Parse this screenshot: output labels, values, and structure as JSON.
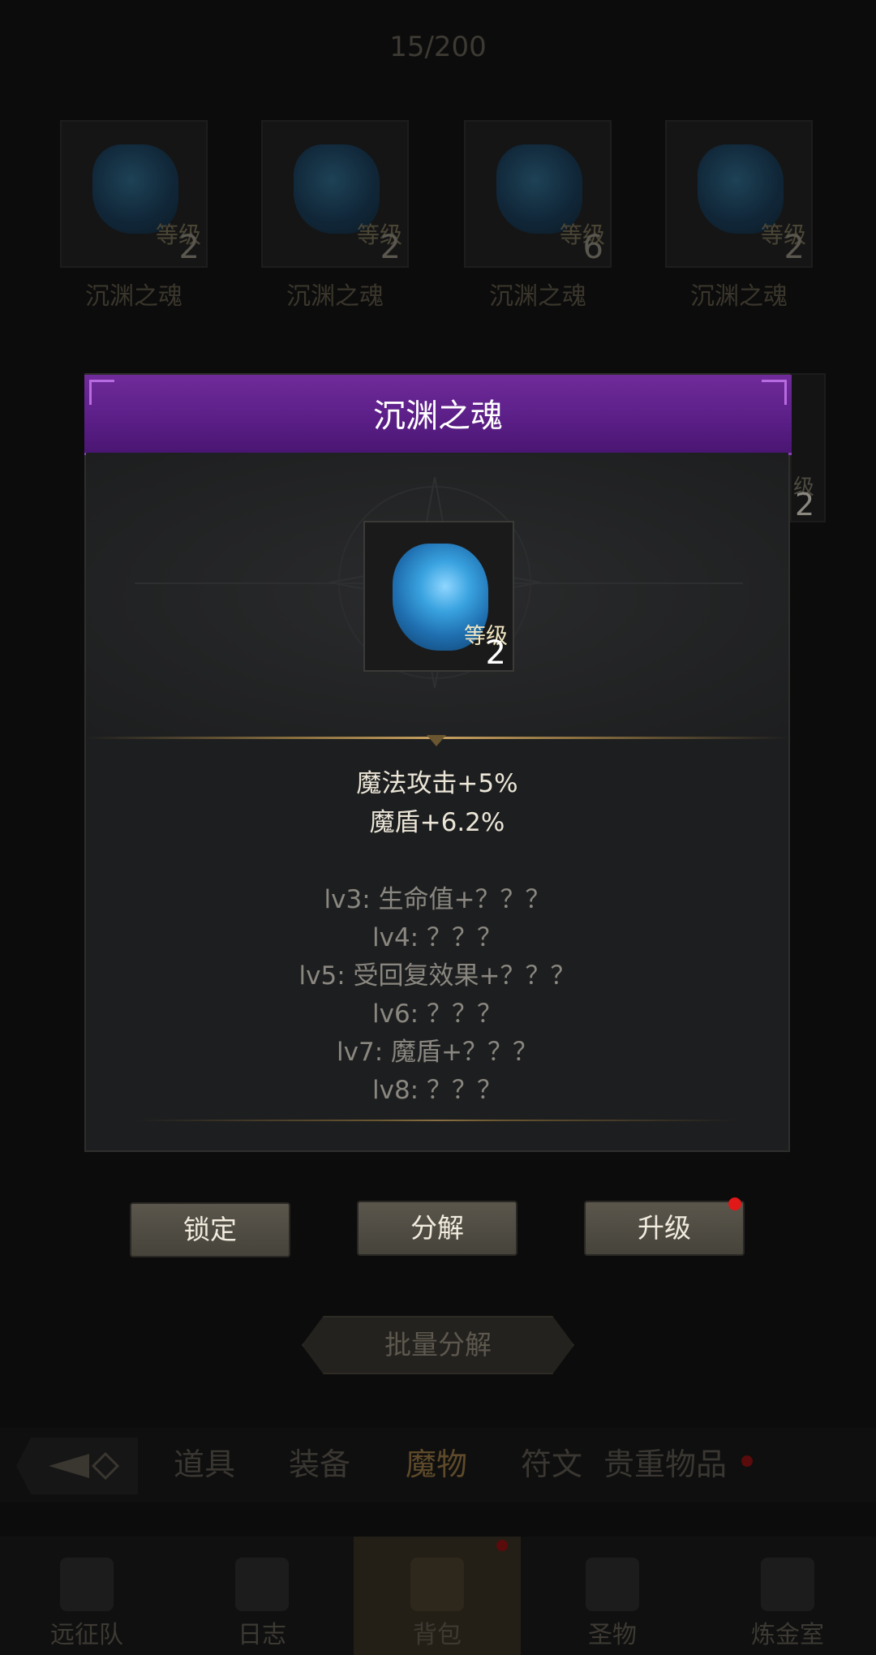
{
  "inventory": {
    "capacity": "15/200",
    "items": [
      {
        "name": "沉渊之魂",
        "level_label": "等级",
        "level": "2"
      },
      {
        "name": "沉渊之魂",
        "level_label": "等级",
        "level": "2"
      },
      {
        "name": "沉渊之魂",
        "level_label": "等级",
        "level": "6"
      },
      {
        "name": "沉渊之魂",
        "level_label": "等级",
        "level": "2"
      }
    ],
    "peek": {
      "level_label": "级",
      "level": "2"
    }
  },
  "popup": {
    "title": "沉渊之魂",
    "item": {
      "level_label": "等级",
      "level": "2"
    },
    "stats": [
      "魔法攻击+5%",
      "魔盾+6.2%"
    ],
    "locked_stats": [
      "lv3: 生命值+？？？",
      "lv4: ？？？",
      "lv5: 受回复效果+？？？",
      "lv6: ？？？",
      "lv7: 魔盾+？？？",
      "lv8: ？？？"
    ]
  },
  "actions": {
    "lock": "锁定",
    "decompose": "分解",
    "upgrade": "升级",
    "batch_decompose": "批量分解"
  },
  "tabs": [
    "道具",
    "装备",
    "魔物",
    "符文",
    "贵重物品"
  ],
  "active_tab": "魔物",
  "nav": [
    "远征队",
    "日志",
    "背包",
    "圣物",
    "炼金室"
  ],
  "active_nav": "背包",
  "colors": {
    "header_purple": "#5a1e86",
    "notification_red": "#e01818",
    "gem_blue": "#3aa3e0"
  }
}
